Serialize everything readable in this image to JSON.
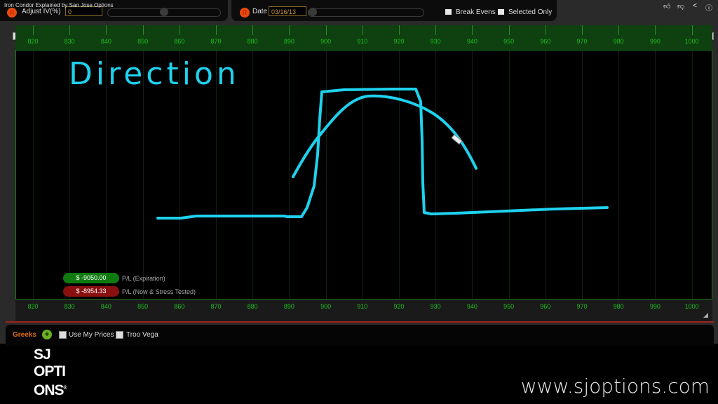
{
  "video": {
    "title": "Iron Condor Explained by San Jose Options",
    "icons": [
      "thumbs-up-icon",
      "thumbs-down-icon",
      "share-icon",
      "info-icon"
    ]
  },
  "toolbar": {
    "iv": {
      "reset": "R",
      "label": "Adjust IV(%)",
      "value": "0",
      "slider_fraction": 0.5
    },
    "date": {
      "reset": "R",
      "label": "Date",
      "value": "03/16/13",
      "slider_fraction": 0.0
    },
    "break_evens_label": "Break Evens",
    "selected_only_label": "Selected Only"
  },
  "chart": {
    "x_ticks": [
      "820",
      "830",
      "840",
      "850",
      "860",
      "870",
      "880",
      "890",
      "900",
      "910",
      "920",
      "930",
      "940",
      "950",
      "960",
      "970",
      "980",
      "990",
      "1000"
    ],
    "annotation": "Direction",
    "line_color": "#1ed2ee",
    "pl_expiration": {
      "value": "$ -9050.00",
      "label": "P/L (Expiration)",
      "color": "#0f7a10"
    },
    "pl_now": {
      "value": "$ -8954.33",
      "label": "P/L (Now & Stress Tested)",
      "color": "#8a1010"
    }
  },
  "greeks": {
    "title": "Greeks",
    "add": "+",
    "use_my_prices": "Use My Prices",
    "troo_vega": "Troo Vega"
  },
  "branding": {
    "logo_lines": [
      "SJ",
      "OPTI",
      "ONS"
    ],
    "logo_mark": "®",
    "website": "www.sjoptions.com"
  }
}
